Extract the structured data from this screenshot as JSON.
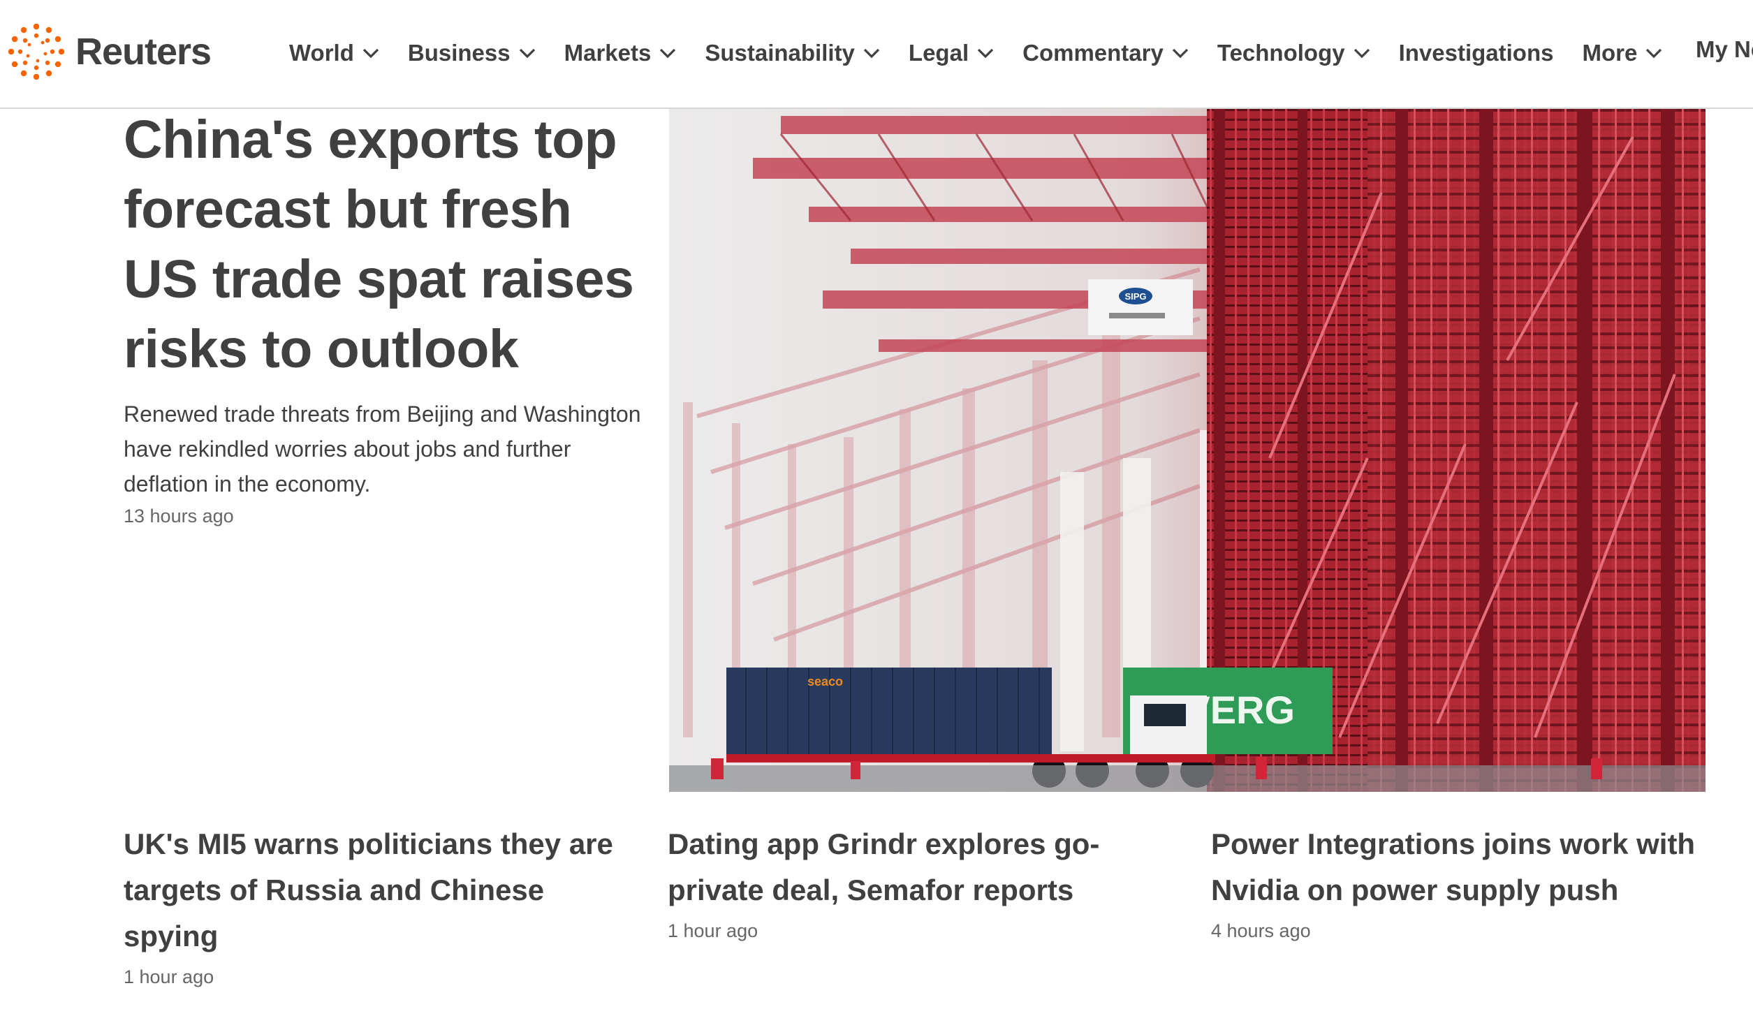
{
  "brand": {
    "name": "Reuters",
    "accent": "#fa6400"
  },
  "nav": {
    "items": [
      {
        "label": "World",
        "has_dropdown": true
      },
      {
        "label": "Business",
        "has_dropdown": true
      },
      {
        "label": "Markets",
        "has_dropdown": true
      },
      {
        "label": "Sustainability",
        "has_dropdown": true
      },
      {
        "label": "Legal",
        "has_dropdown": true
      },
      {
        "label": "Commentary",
        "has_dropdown": true
      },
      {
        "label": "Technology",
        "has_dropdown": true
      },
      {
        "label": "Investigations",
        "has_dropdown": false
      },
      {
        "label": "More",
        "has_dropdown": true
      }
    ],
    "my_news": "My Ne"
  },
  "lead": {
    "title": "China's exports top forecast but fresh US trade spat raises risks to outlook",
    "description": "Renewed trade threats from Beijing and Washington have rekindled worries about jobs and further deflation in the economy.",
    "time": "13 hours ago",
    "photo": {
      "container_brand_1": "seaco",
      "container_brand_2": "EVERG",
      "sign": "SIPG"
    }
  },
  "stories": [
    {
      "title": "UK's MI5 warns politicians they are targets of Russia and Chinese spying",
      "time": "1 hour ago"
    },
    {
      "title": "Dating app Grindr explores go-private deal, Semafor reports",
      "time": "1 hour ago"
    },
    {
      "title": "Power Integrations joins work with Nvidia on power supply push",
      "time": "4 hours ago"
    }
  ]
}
